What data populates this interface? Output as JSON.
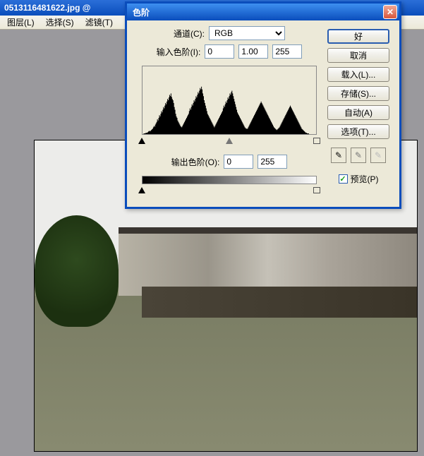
{
  "app": {
    "titlebar_filename": "0513116481622.jpg @",
    "menu": {
      "layers": "图层(L)",
      "select": "选择(S)",
      "filter": "滤镜(T)"
    }
  },
  "dialog": {
    "title": "色阶",
    "channel_label": "通道(C):",
    "channel_value": "RGB",
    "input_levels_label": "输入色阶(I):",
    "input_black": "0",
    "input_gamma": "1.00",
    "input_white": "255",
    "output_levels_label": "输出色阶(O):",
    "output_black": "0",
    "output_white": "255",
    "buttons": {
      "ok": "好",
      "cancel": "取消",
      "load": "载入(L)...",
      "save": "存储(S)...",
      "auto": "自动(A)",
      "options": "选项(T)..."
    },
    "preview_label": "预览(P)",
    "preview_checked": true
  },
  "chart_data": {
    "type": "bar",
    "title": "",
    "xlabel": "",
    "ylabel": "",
    "categories_range": [
      0,
      255
    ],
    "ylim": [
      0,
      100
    ],
    "values": [
      0,
      0,
      1,
      1,
      1,
      2,
      2,
      2,
      3,
      4,
      5,
      4,
      5,
      6,
      7,
      8,
      10,
      12,
      11,
      14,
      16,
      18,
      22,
      20,
      24,
      28,
      26,
      30,
      34,
      32,
      36,
      40,
      38,
      42,
      46,
      44,
      48,
      52,
      50,
      54,
      58,
      56,
      60,
      55,
      52,
      50,
      46,
      40,
      36,
      30,
      26,
      24,
      20,
      18,
      16,
      14,
      12,
      11,
      10,
      12,
      14,
      16,
      18,
      20,
      22,
      24,
      26,
      28,
      30,
      34,
      38,
      36,
      40,
      44,
      42,
      46,
      50,
      48,
      52,
      56,
      54,
      58,
      62,
      60,
      64,
      68,
      66,
      70,
      66,
      60,
      56,
      50,
      46,
      42,
      38,
      34,
      30,
      28,
      26,
      24,
      22,
      20,
      18,
      16,
      14,
      12,
      10,
      12,
      14,
      16,
      18,
      20,
      22,
      24,
      26,
      28,
      30,
      32,
      34,
      38,
      42,
      40,
      44,
      48,
      46,
      50,
      54,
      52,
      56,
      60,
      58,
      62,
      64,
      60,
      56,
      52,
      48,
      44,
      40,
      36,
      32,
      30,
      28,
      26,
      24,
      22,
      20,
      18,
      16,
      14,
      12,
      10,
      9,
      8,
      8,
      8,
      10,
      12,
      14,
      16,
      18,
      20,
      22,
      24,
      26,
      28,
      30,
      32,
      34,
      36,
      38,
      40,
      42,
      44,
      46,
      48,
      46,
      44,
      42,
      40,
      38,
      36,
      34,
      32,
      30,
      28,
      26,
      24,
      22,
      20,
      18,
      16,
      14,
      12,
      10,
      9,
      8,
      7,
      6,
      7,
      8,
      9,
      10,
      12,
      14,
      16,
      18,
      20,
      22,
      24,
      26,
      28,
      30,
      32,
      34,
      36,
      38,
      40,
      42,
      40,
      38,
      36,
      34,
      32,
      30,
      28,
      26,
      24,
      22,
      20,
      18,
      16,
      14,
      12,
      10,
      8,
      7,
      6,
      5,
      4,
      3,
      2,
      2,
      1,
      1,
      1,
      0,
      0,
      0,
      0,
      0,
      0,
      0,
      0,
      0,
      0
    ]
  }
}
